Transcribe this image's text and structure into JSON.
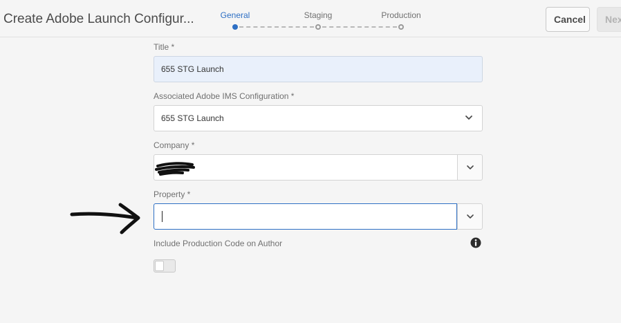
{
  "header": {
    "title": "Create Adobe Launch Configur...",
    "steps": [
      {
        "label": "General",
        "state": "active"
      },
      {
        "label": "Staging",
        "state": "pending"
      },
      {
        "label": "Production",
        "state": "pending"
      }
    ],
    "cancel_label": "Cancel",
    "next_label": "Next"
  },
  "form": {
    "title_label": "Title *",
    "title_value": "655 STG Launch",
    "ims_label": "Associated Adobe IMS Configuration *",
    "ims_value": "655 STG Launch",
    "company_label": "Company *",
    "property_label": "Property *",
    "include_label": "Include Production Code on Author",
    "include_toggle": false
  },
  "icons": {
    "ims_dropdown": "chevron-down-icon",
    "company_dropdown": "chevron-down-icon",
    "property_dropdown": "chevron-down-icon",
    "info": "info-icon"
  },
  "colors": {
    "accent": "#2d6fc4",
    "filled_field": "#e9f0fb",
    "background": "#f5f5f5"
  }
}
